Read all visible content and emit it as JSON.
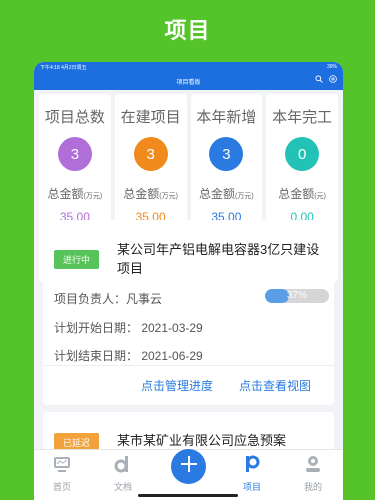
{
  "banner": {
    "title": "项目"
  },
  "status_bar": {
    "time": "下午4:18  4月2日周五",
    "battery": "39%"
  },
  "nav": {
    "title": "项目看板",
    "icons": [
      "search-icon",
      "add-circle-icon"
    ]
  },
  "stats": [
    {
      "title": "项目总数",
      "count": "3",
      "amount_label": "总金额",
      "unit": "(万元)",
      "amount": "35.00",
      "color": "#b06fd8"
    },
    {
      "title": "在建项目",
      "count": "3",
      "amount_label": "总金额",
      "unit": "(万元)",
      "amount": "35.00",
      "color": "#f08a1c"
    },
    {
      "title": "本年新增",
      "count": "3",
      "amount_label": "总金额",
      "unit": "(万元)",
      "amount": "35.00",
      "color": "#2a7ae2"
    },
    {
      "title": "本年完工",
      "count": "0",
      "amount_label": "总金额",
      "unit": "(元)",
      "amount": "0.00",
      "color": "#22c3b6"
    }
  ],
  "projects": [
    {
      "status": "进行中",
      "status_color": "#56c45a",
      "name": "某公司年产铝电解电容器3亿只建设项目",
      "manager": "项目负责人：凡事云",
      "progress": 37,
      "progress_text": "37%",
      "start": "计划开始日期：  2021-03-29",
      "end": "计划结束日期：  2021-06-29",
      "link_progress": "点击管理进度",
      "link_view": "点击查看视图"
    },
    {
      "status": "已延迟",
      "status_color": "#f2a23a",
      "name": "某市某矿业有限公司应急预案"
    }
  ],
  "tabs": [
    {
      "label": "首页",
      "icon": "home-monitor-icon"
    },
    {
      "label": "文档",
      "icon": "document-icon"
    },
    {
      "label": "项目",
      "icon": "project-icon",
      "active": true
    },
    {
      "label": "我的",
      "icon": "user-icon"
    }
  ],
  "colors": {
    "accent": "#2a7ae2",
    "background": "#54c42a"
  }
}
